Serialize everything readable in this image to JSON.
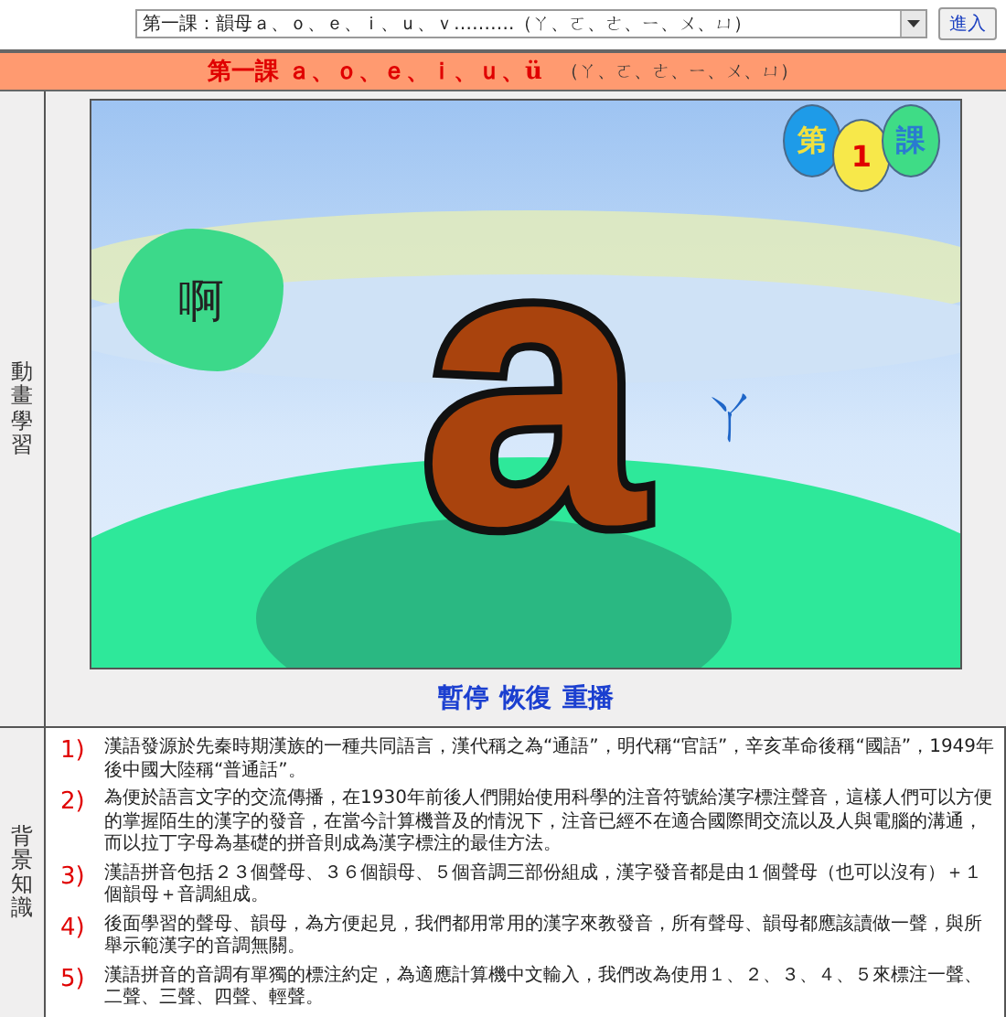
{
  "lesson_select": {
    "value": "第一課：韻母ａ、ｏ、ｅ、ｉ、ｕ、ｖ……….（ㄚ、ㄛ、ㄜ、ㄧ、ㄨ、ㄩ）"
  },
  "enter_button": "進入",
  "header": {
    "title": "第一課 ａ、ｏ、ｅ、ｉ、ｕ、ü",
    "zhuyin": "（ㄚ、ㄛ、ㄜ、ㄧ、ㄨ、ㄩ）"
  },
  "animation_section": {
    "label": "動畫學習",
    "balloons": [
      {
        "text": "第",
        "color": "#1e9be8"
      },
      {
        "text": "1",
        "color": "#f7e84a"
      },
      {
        "text": "課",
        "color": "#3fdc86"
      }
    ],
    "cloud_text": "啊",
    "letter": "a",
    "zhuyin": "ㄚ",
    "controls": [
      "暫停",
      "恢復",
      "重播"
    ]
  },
  "background_section": {
    "label": "背景知識",
    "items": [
      {
        "number": "1)",
        "text": "漢語發源於先秦時期漢族的一種共同語言，漢代稱之為“通語”，明代稱“官話”，辛亥革命後稱“國語”，1949年後中國大陸稱“普通話”。"
      },
      {
        "number": "2)",
        "text": "為便於語言文字的交流傳播，在1930年前後人們開始使用科學的注音符號給漢字標注聲音，這樣人們可以方便的掌握陌生的漢字的發音，在當今計算機普及的情況下，注音已經不在適合國際間交流以及人與電腦的溝通，而以拉丁字母為基礎的拼音則成為漢字標注的最佳方法。"
      },
      {
        "number": "3)",
        "text": "漢語拼音包括２３個聲母、３６個韻母、５個音調三部份組成，漢字發音都是由１個聲母（也可以沒有）＋１個韻母＋音調組成。"
      },
      {
        "number": "4)",
        "text": "後面學習的聲母、韻母，為方便起見，我們都用常用的漢字來教發音，所有聲母、韻母都應該讀做一聲，與所舉示範漢字的音調無關。"
      },
      {
        "number": "5)",
        "text": "漢語拼音的音調有單獨的標注約定，為適應計算機中文輸入，我們改為使用１、２、３、４、５來標注一聲、二聲、三聲、四聲、輕聲。"
      }
    ]
  }
}
